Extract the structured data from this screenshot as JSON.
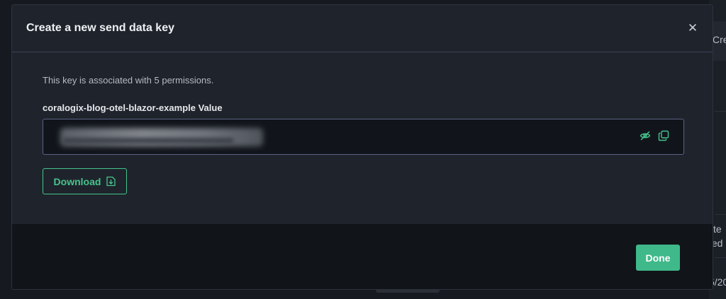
{
  "background": {
    "text_top": "Cre",
    "text_mid_1": "te",
    "text_mid_2": "ted",
    "text_bottom": "5/20"
  },
  "modal": {
    "title": "Create a new send data key",
    "close_icon": "close-icon",
    "association_text": "This key is associated with 5 permissions.",
    "key_field": {
      "label": "coralogix-blog-otel-blazor-example Value",
      "value_state": "masked",
      "icons": [
        "eye-off-icon",
        "copy-icon"
      ]
    },
    "download_button": {
      "label": "Download",
      "icon": "download-file-icon"
    },
    "done_button": {
      "label": "Done"
    }
  },
  "colors": {
    "accent": "#46c48d",
    "done_bg": "#3fb98a",
    "modal_bg": "#1f242c",
    "footer_bg": "#111419",
    "input_border": "#5b6185"
  }
}
